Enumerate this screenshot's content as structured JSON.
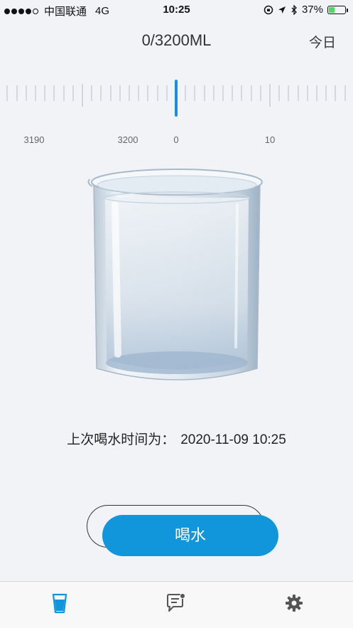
{
  "status_bar": {
    "carrier": "中国联通",
    "network": "4G",
    "time": "10:25",
    "battery": "37%",
    "battery_level": 0.37
  },
  "header": {
    "title": "0/3200ML",
    "today_label": "今日"
  },
  "ruler": {
    "labels": [
      "3190",
      "3200",
      "0",
      "10"
    ],
    "pointer_value": 0,
    "accent_color": "#1a8fe0"
  },
  "last_drink": {
    "label": "上次喝水时间为：",
    "time": "2020-11-09 10:25"
  },
  "actions": {
    "drink_label": "喝水",
    "button_color": "#1296db"
  },
  "tabs": [
    {
      "name": "water-cup-icon",
      "active": true
    },
    {
      "name": "chat-bubble-icon",
      "active": false
    },
    {
      "name": "gear-icon",
      "active": false
    }
  ],
  "watermark": "◆"
}
